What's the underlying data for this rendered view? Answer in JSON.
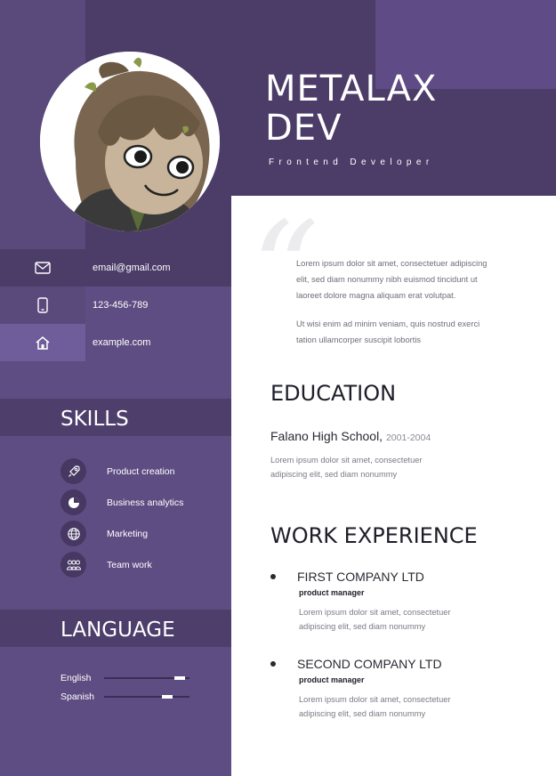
{
  "header": {
    "name_line1": "METALAX",
    "name_line2": "DEV",
    "role": "Frontend Developer"
  },
  "contact": {
    "email": "email@gmail.com",
    "phone": "123-456-789",
    "website": "example.com"
  },
  "skills": {
    "heading": "SKILLS",
    "items": [
      {
        "label": "Product creation",
        "icon": "rocket-icon"
      },
      {
        "label": "Business analytics",
        "icon": "pie-chart-icon"
      },
      {
        "label": "Marketing",
        "icon": "globe-icon"
      },
      {
        "label": "Team work",
        "icon": "team-icon"
      }
    ]
  },
  "language": {
    "heading": "LANGUAGE",
    "items": [
      {
        "label": "English",
        "level": 0.95
      },
      {
        "label": "Spanish",
        "level": 0.8
      }
    ]
  },
  "intro": {
    "paragraph1": "Lorem ipsum dolor sit amet, consectetuer adipiscing elit, sed diam nonummy nibh euismod tincidunt ut laoreet dolore magna aliquam erat volutpat.",
    "paragraph2": "Ut wisi enim ad minim veniam, quis nostrud exerci tation ullamcorper suscipit lobortis"
  },
  "education": {
    "heading": "EDUCATION",
    "school": "Falano High School,",
    "years": "2001-2004",
    "description": "Lorem ipsum dolor sit amet, consectetuer adipiscing elit, sed diam nonummy"
  },
  "work": {
    "heading": "WORK EXPERIENCE",
    "jobs": [
      {
        "company": "FIRST COMPANY LTD",
        "role": "product manager",
        "description": "Lorem ipsum dolor sit amet, consectetuer adipiscing elit, sed diam nonummy"
      },
      {
        "company": "SECOND COMPANY LTD",
        "role": "product manager",
        "description": "Lorem ipsum dolor sit amet, consectetuer adipiscing elit, sed diam nonummy"
      }
    ]
  },
  "colors": {
    "sidebar": "#5e4d82",
    "sidebar_dark": "#4b3c68",
    "contact_highlight": "#6f5c9a"
  }
}
